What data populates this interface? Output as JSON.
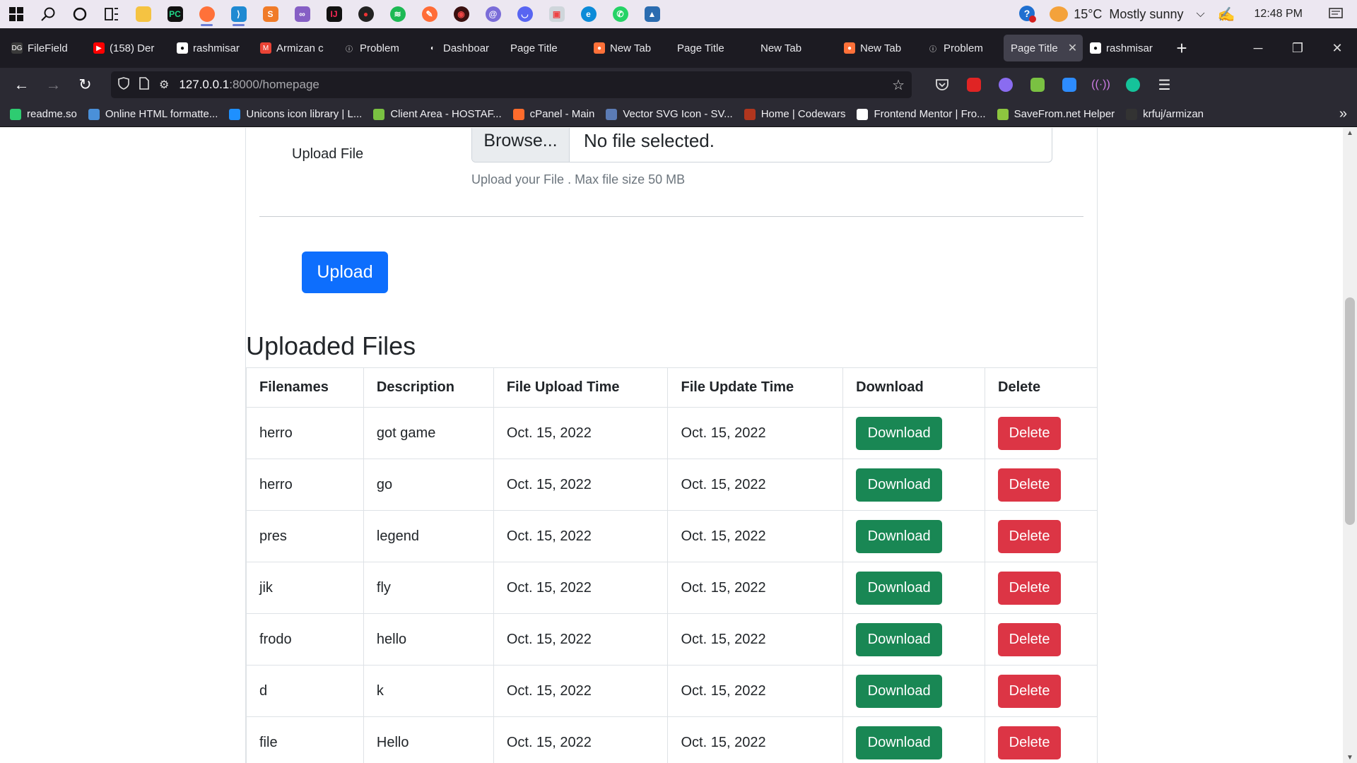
{
  "taskbar": {
    "weather_temp": "15°C",
    "weather_text": "Mostly sunny",
    "clock": "12:48 PM"
  },
  "tabs": [
    {
      "label": "FileField",
      "color": "#3a3a3a",
      "glyph": "DG"
    },
    {
      "label": "(158) Der",
      "color": "#ff0000",
      "glyph": "▶"
    },
    {
      "label": "rashmisar",
      "color": "#ffffff",
      "glyph": "●"
    },
    {
      "label": "Armizan c",
      "color": "#ea4335",
      "glyph": "M"
    },
    {
      "label": "Problem",
      "color": "#1c1b22",
      "glyph": "ⓘ"
    },
    {
      "label": "Dashboar",
      "color": "#1c1b22",
      "glyph": "◐"
    },
    {
      "label": "Page Title",
      "color": "",
      "glyph": ""
    },
    {
      "label": "New Tab",
      "color": "#ff7139",
      "glyph": "●"
    },
    {
      "label": "Page Title",
      "color": "",
      "glyph": ""
    },
    {
      "label": "New Tab",
      "color": "",
      "glyph": ""
    },
    {
      "label": "New Tab",
      "color": "#ff7139",
      "glyph": "●"
    },
    {
      "label": "Problem",
      "color": "#1c1b22",
      "glyph": "ⓘ"
    },
    {
      "label": "Page Title",
      "color": "",
      "glyph": ""
    },
    {
      "label": "rashmisar",
      "color": "#ffffff",
      "glyph": "●"
    }
  ],
  "nav": {
    "url_host": "127.0.0.1",
    "url_path": ":8000/homepage"
  },
  "bookmarks": [
    {
      "label": "readme.so",
      "color": "#2ecc71"
    },
    {
      "label": "Online HTML formatte...",
      "color": "#4a90d9"
    },
    {
      "label": "Unicons icon library | L...",
      "color": "#1e90ff"
    },
    {
      "label": "Client Area - HOSTAF...",
      "color": "#7ac142"
    },
    {
      "label": "cPanel - Main",
      "color": "#ff6c2c"
    },
    {
      "label": "Vector SVG Icon - SV...",
      "color": "#5b7bb5"
    },
    {
      "label": "Home | Codewars",
      "color": "#b1361e"
    },
    {
      "label": "Frontend Mentor | Fro...",
      "color": "#ffffff"
    },
    {
      "label": "SaveFrom.net Helper",
      "color": "#8dc63f"
    },
    {
      "label": "krfuj/armizan",
      "color": "#333333"
    }
  ],
  "form": {
    "upload_label": "Upload File",
    "browse_label": "Browse...",
    "no_file_text": "No file selected.",
    "help_text": "Upload your File . Max file size 50 MB",
    "upload_button": "Upload"
  },
  "files_section": {
    "title": "Uploaded Files",
    "headers": [
      "Filenames",
      "Description",
      "File Upload Time",
      "File Update Time",
      "Download",
      "Delete"
    ],
    "download_label": "Download",
    "delete_label": "Delete",
    "rows": [
      {
        "filename": "herro",
        "description": "got game",
        "upload_time": "Oct. 15, 2022",
        "update_time": "Oct. 15, 2022"
      },
      {
        "filename": "herro",
        "description": "go",
        "upload_time": "Oct. 15, 2022",
        "update_time": "Oct. 15, 2022"
      },
      {
        "filename": "pres",
        "description": "legend",
        "upload_time": "Oct. 15, 2022",
        "update_time": "Oct. 15, 2022"
      },
      {
        "filename": "jik",
        "description": "fly",
        "upload_time": "Oct. 15, 2022",
        "update_time": "Oct. 15, 2022"
      },
      {
        "filename": "frodo",
        "description": "hello",
        "upload_time": "Oct. 15, 2022",
        "update_time": "Oct. 15, 2022"
      },
      {
        "filename": "d",
        "description": "k",
        "upload_time": "Oct. 15, 2022",
        "update_time": "Oct. 15, 2022"
      },
      {
        "filename": "file",
        "description": "Hello",
        "upload_time": "Oct. 15, 2022",
        "update_time": "Oct. 15, 2022"
      }
    ]
  }
}
